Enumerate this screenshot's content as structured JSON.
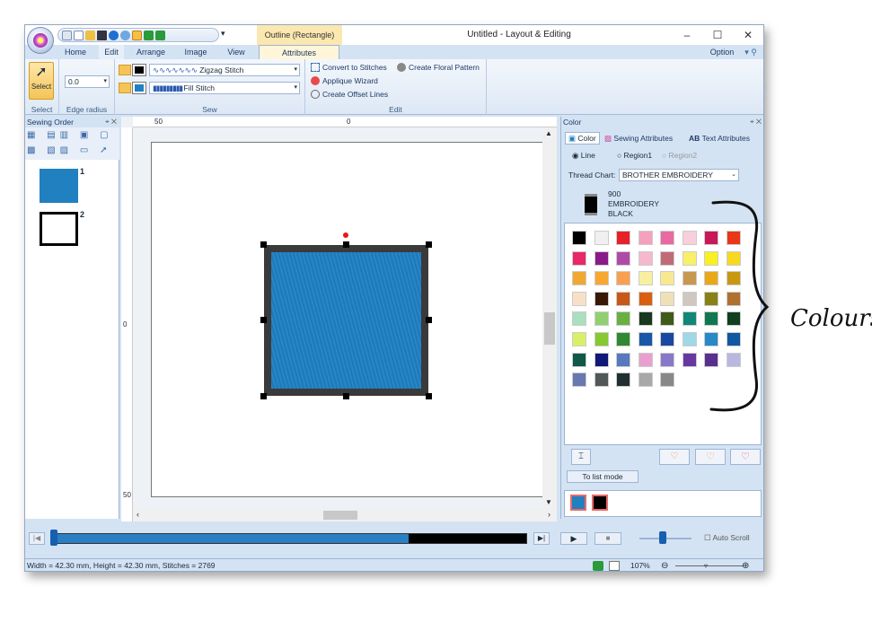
{
  "window": {
    "title": "Untitled - Layout & Editing",
    "contextual_tab": "Outline (Rectangle)",
    "controls": [
      "–",
      "☐",
      "✕"
    ]
  },
  "tabs": [
    "Home",
    "Edit",
    "Arrange",
    "Image",
    "View",
    "Attributes"
  ],
  "active_tab": "Attributes",
  "option_label": "Option",
  "ribbon": {
    "select": {
      "button": "Select",
      "label": "Select"
    },
    "edge_radius": {
      "value": "0.0",
      "label": "Edge radius"
    },
    "sew": {
      "line_stitch": "Zigzag Stitch",
      "fill_stitch": "Fill Stitch",
      "label": "Sew"
    },
    "edit": {
      "convert": "Convert to Stitches",
      "floral": "Create Floral Pattern",
      "applique": "Applique Wizard",
      "offset": "Create Offset Lines",
      "label": "Edit"
    }
  },
  "sewing_order": {
    "title": "Sewing Order",
    "items": [
      {
        "num": "1",
        "color": "#2080c0",
        "kind": "filled"
      },
      {
        "num": "2",
        "color": "#000000",
        "kind": "outline"
      }
    ]
  },
  "rulers": {
    "h": [
      "50",
      "0"
    ],
    "v": [
      "0",
      "50"
    ]
  },
  "color_panel": {
    "title": "Color",
    "tabs": [
      "Color",
      "Sewing Attributes",
      "Text Attributes"
    ],
    "radios": [
      "Line",
      "Region1",
      "Region2"
    ],
    "thread_chart_label": "Thread Chart:",
    "thread_chart_value": "BROTHER EMBROIDERY",
    "thread": {
      "code": "900",
      "name1": "EMBROIDERY",
      "name2": "BLACK",
      "color": "#000000"
    },
    "list_mode_button": "To list mode",
    "swatches": [
      "#000000",
      "#f0f0f0",
      "#e8202a",
      "#f6a0c0",
      "#e86aa0",
      "#f8d0dc",
      "#c8185a",
      "#e83818",
      "#e82868",
      "#8a1a8a",
      "#b04aa8",
      "#f5b8cc",
      "#c06a78",
      "#f8f068",
      "#f8f020",
      "#f8d820",
      "#f0a830",
      "#f8a830",
      "#f8a050",
      "#f8f0a0",
      "#f8e890",
      "#c89850",
      "#e8a818",
      "#c89810",
      "#f8e0c8",
      "#3a1808",
      "#c85818",
      "#d86010",
      "#f0e0b8",
      "#d0c8c0",
      "#8a8018",
      "#b07030",
      "#a8e0c0",
      "#90d070",
      "#68b040",
      "#183820",
      "#405a18",
      "#108878",
      "#107850",
      "#104020",
      "#d8f068",
      "#88c830",
      "#308830",
      "#1858a8",
      "#1848a0",
      "#a0d8e8",
      "#2888c8",
      "#1058a0",
      "#105848",
      "#101878",
      "#5878c0",
      "#e8a0d0",
      "#8878c8",
      "#6838a0",
      "#583090",
      "#b8b8e0",
      "#6878b0",
      "#505858",
      "#203030",
      "#a8a8a8",
      "#888888"
    ],
    "current_colors": [
      "#2080c0",
      "#000000"
    ]
  },
  "player": {
    "auto_scroll": "Auto Scroll",
    "progress": 0.75
  },
  "status": {
    "text": "Width = 42.30 mm, Height = 42.30 mm, Stitches = 2769",
    "zoom": "107%"
  },
  "annotation": "Colours"
}
